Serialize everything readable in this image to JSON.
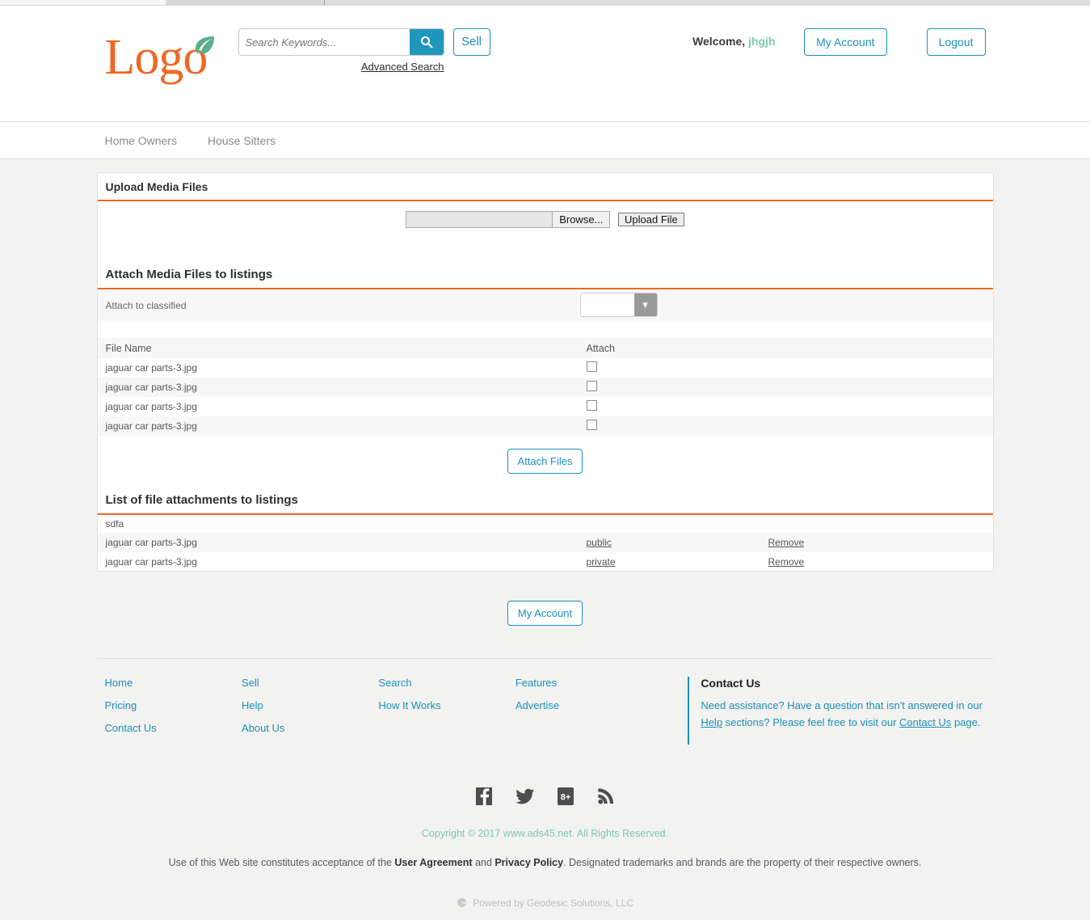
{
  "browser": {
    "tabs": [
      "",
      "",
      ""
    ]
  },
  "header": {
    "logo_text": "Logo",
    "logo_color": "#ef6724",
    "leaf_color": "#5bae8e",
    "search": {
      "placeholder": "Search Keywords...",
      "value": "",
      "icon": "search-icon",
      "advanced_label": "Advanced Search"
    },
    "sell_label": "Sell",
    "welcome_prefix": "Welcome,",
    "username": "jhgjh",
    "my_account_label": "My Account",
    "logout_label": "Logout",
    "accent_color": "#1d8fb8"
  },
  "nav": {
    "items": [
      {
        "label": "Home Owners"
      },
      {
        "label": "House Sitters"
      }
    ]
  },
  "upload_panel": {
    "title": "Upload Media Files",
    "file_input_value": "",
    "browse_label": "Browse...",
    "upload_label": "Upload File"
  },
  "attach_panel": {
    "title": "Attach Media Files to listings",
    "classified_label": "Attach to classified",
    "classified_value": "",
    "classified_options": [
      ""
    ],
    "columns": {
      "name": "File Name",
      "attach": "Attach"
    },
    "files": [
      {
        "name": "jaguar car parts-3.jpg",
        "checked": false
      },
      {
        "name": "jaguar car parts-3.jpg",
        "checked": false
      },
      {
        "name": "jaguar car parts-3.jpg",
        "checked": false
      },
      {
        "name": "jaguar car parts-3.jpg",
        "checked": false
      }
    ],
    "attach_button_label": "Attach Files"
  },
  "attachments_panel": {
    "title": "List of file attachments to listings",
    "group_label": "sdfa",
    "rows": [
      {
        "name": "jaguar car parts-3.jpg",
        "visibility": "public",
        "action": "Remove"
      },
      {
        "name": "jaguar car parts-3.jpg",
        "visibility": "private",
        "action": "Remove"
      }
    ]
  },
  "bottom": {
    "my_account_label": "My Account"
  },
  "footer": {
    "columns": [
      {
        "links": [
          "Home",
          "Pricing",
          "Contact Us"
        ]
      },
      {
        "links": [
          "Sell",
          "Help",
          "About Us"
        ]
      },
      {
        "links": [
          "Search",
          "How It Works"
        ]
      },
      {
        "links": [
          "Features",
          "Advertise"
        ]
      }
    ],
    "contact": {
      "title": "Contact Us",
      "text_1": "Need assistance? Have a question that isn't answered in our ",
      "link_1": "Help",
      "text_2": " sections? Please feel free to visit our ",
      "link_2": "Contact Us",
      "text_3": " page."
    },
    "social": [
      {
        "name": "facebook-icon"
      },
      {
        "name": "twitter-icon"
      },
      {
        "name": "google-plus-icon"
      },
      {
        "name": "rss-icon"
      }
    ],
    "copyright": "Copyright © 2017 www.ads45.net. All Rights Reserved.",
    "legal_1": "Use of this Web site constitutes acceptance of the ",
    "legal_link_1": "User Agreement",
    "legal_2": " and ",
    "legal_link_2": "Privacy Policy",
    "legal_3": ". Designated trademarks and brands are the property of their respective owners.",
    "powered": "Powered by Geodesic Solutions, LLC"
  }
}
